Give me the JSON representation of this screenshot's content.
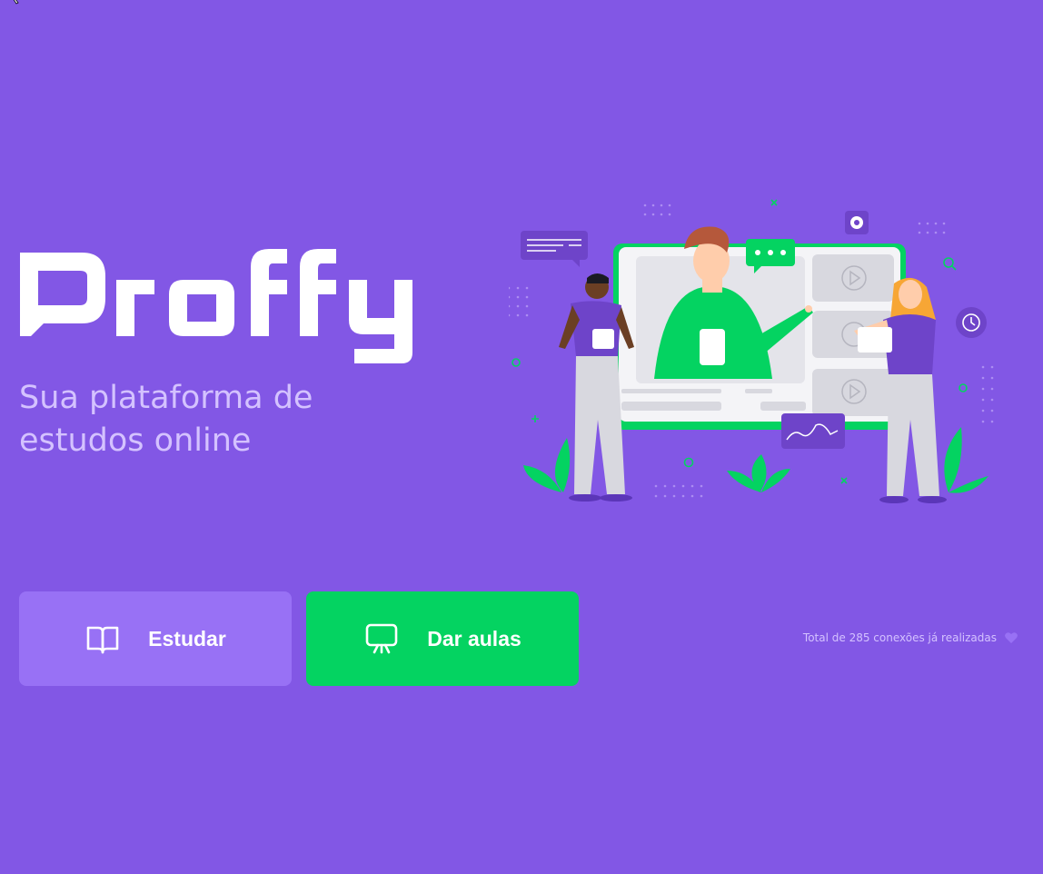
{
  "app": {
    "logo_text": "Proffy",
    "tagline_line1": "Sua plataforma de",
    "tagline_line2": "estudos online"
  },
  "hero": {
    "illustration": "online-classes-illustration",
    "colors": {
      "background": "#8257e5",
      "accent_green": "#04d361",
      "button_purple": "#9871f5",
      "text_light": "#d4c2ff"
    }
  },
  "actions": {
    "study_label": "Estudar",
    "study_icon": "open-book-icon",
    "give_classes_label": "Dar aulas",
    "give_classes_icon": "presentation-board-icon"
  },
  "footer": {
    "total_connections": "Total de 285 conexões já realizadas",
    "heart_icon": "heart-icon"
  }
}
